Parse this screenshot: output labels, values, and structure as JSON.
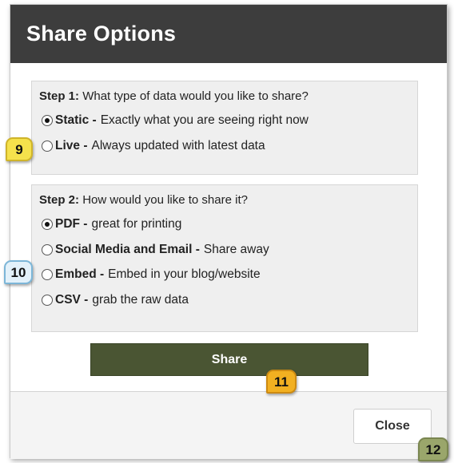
{
  "dialog": {
    "title": "Share Options"
  },
  "step1": {
    "label": "Step 1:",
    "question": "What type of data would you like to share?",
    "options": [
      {
        "name": "Static -",
        "description": "Exactly what you are seeing right now",
        "selected": true
      },
      {
        "name": "Live -",
        "description": "Always updated with latest data",
        "selected": false
      }
    ]
  },
  "step2": {
    "label": "Step 2:",
    "question": "How would you like to share it?",
    "options": [
      {
        "name": "PDF -",
        "description": "great for printing",
        "selected": true
      },
      {
        "name": "Social Media and Email -",
        "description": "Share away",
        "selected": false
      },
      {
        "name": "Embed -",
        "description": "Embed in your blog/website",
        "selected": false
      },
      {
        "name": "CSV -",
        "description": "grab the raw data",
        "selected": false
      }
    ]
  },
  "buttons": {
    "share": "Share",
    "close": "Close"
  },
  "callouts": {
    "c9": "9",
    "c10": "10",
    "c11": "11",
    "c12": "12"
  },
  "colors": {
    "header": "#3d3d3d",
    "share_button": "#4a5533",
    "panel": "#efefef"
  }
}
